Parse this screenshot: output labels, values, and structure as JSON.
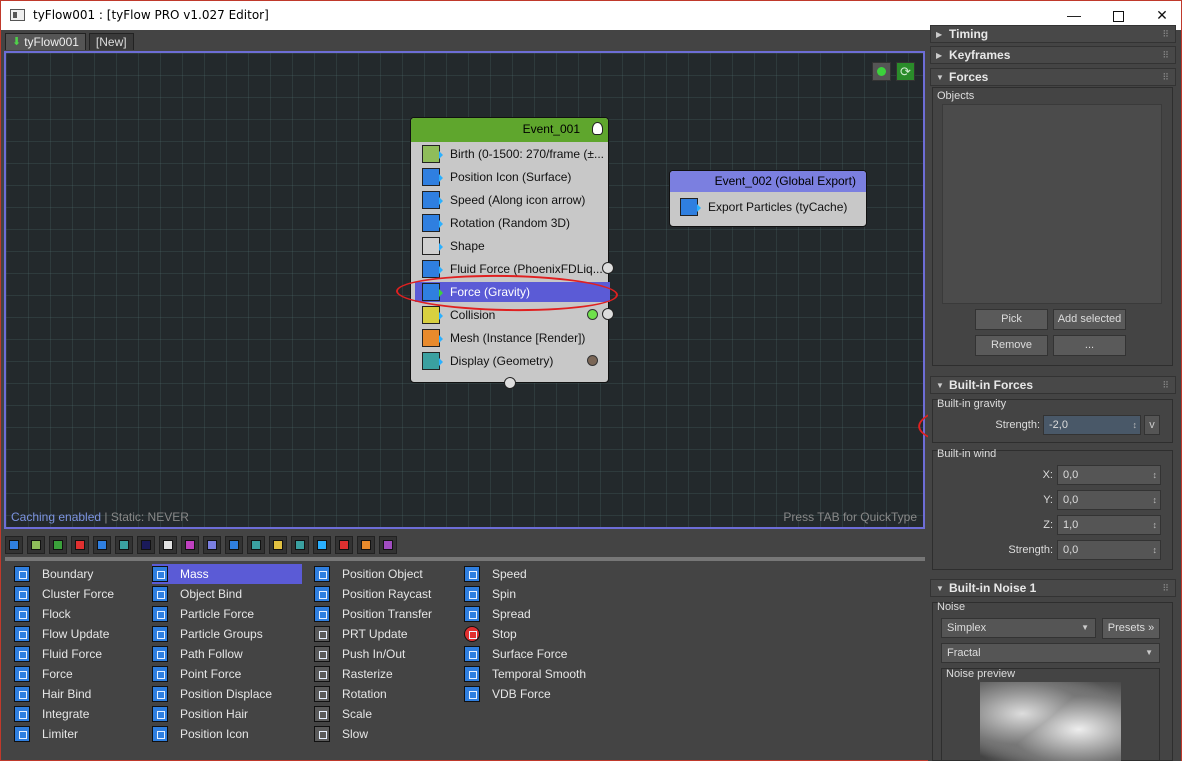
{
  "window": {
    "title": "tyFlow001 : [tyFlow PRO v1.027 Editor]",
    "min": "—",
    "max": "",
    "close": "✕"
  },
  "tabs": [
    {
      "label": "tyFlow001",
      "icon": "green-down-arrow-icon"
    },
    {
      "label": "[New]"
    }
  ],
  "canvas": {
    "status_caching": "Caching enabled",
    "status_static": " | Static: NEVER",
    "hint": "Press TAB for QuickType",
    "refresh_glyph": "⟳"
  },
  "event1": {
    "title": "Event_001",
    "operators": [
      {
        "label": "Birth (0-1500: 270/frame (±...",
        "icon": "birth"
      },
      {
        "label": "Position Icon (Surface)",
        "icon": "blue"
      },
      {
        "label": "Speed (Along icon arrow)",
        "icon": "blue"
      },
      {
        "label": "Rotation (Random 3D)",
        "icon": "blue"
      },
      {
        "label": "Shape",
        "icon": "shape"
      },
      {
        "label": "Fluid Force (PhoenixFDLiq...",
        "icon": "blue"
      },
      {
        "label": "Force (Gravity)",
        "icon": "grav",
        "selected": true
      },
      {
        "label": "Collision",
        "icon": "col"
      },
      {
        "label": "Mesh (Instance [Render])",
        "icon": "mesh"
      },
      {
        "label": "Display (Geometry)",
        "icon": "disp"
      }
    ]
  },
  "event2": {
    "title": "Event_002 (Global Export)",
    "operator": "Export Particles (tyCache)"
  },
  "palette": {
    "colors": [
      "#2f7fe0",
      "#8fbd5a",
      "#3aa03a",
      "#e03030",
      "#2f7fe0",
      "#3aa0a0",
      "#1a1a5a",
      "#e0e0e0",
      "#c040c0",
      "#7b7fe0",
      "#2f7fe0",
      "#3aa0a0",
      "#e0c040",
      "#3aa0a0",
      "#2ab0ff",
      "#e03030",
      "#e88a2c",
      "#a04cc0"
    ],
    "col1": [
      "Boundary",
      "Cluster Force",
      "Flock",
      "Flow Update",
      "Fluid Force",
      "Force",
      "Hair Bind",
      "Integrate",
      "Limiter"
    ],
    "col2": [
      "Mass",
      "Object Bind",
      "Particle Force",
      "Particle Groups",
      "Path Follow",
      "Point Force",
      "Position Displace",
      "Position Hair",
      "Position Icon"
    ],
    "col3": [
      "Position Object",
      "Position Raycast",
      "Position Transfer",
      "PRT Update",
      "Push In/Out",
      "Rasterize",
      "Rotation",
      "Scale",
      "Slow"
    ],
    "col4": [
      "Speed",
      "Spin",
      "Spread",
      "Stop",
      "Surface Force",
      "Temporal Smooth",
      "VDB Force"
    ]
  },
  "panel": {
    "timing": "Timing",
    "keyframes": "Keyframes",
    "forces": "Forces",
    "objects_label": "Objects",
    "pick": "Pick",
    "add_selected": "Add selected",
    "remove": "Remove",
    "more": "...",
    "builtin_forces": "Built-in Forces",
    "builtin_gravity": "Built-in gravity",
    "strength_label": "Strength:",
    "gravity_strength": "-2,0",
    "v": "v",
    "builtin_wind": "Built-in wind",
    "x_label": "X:",
    "x_val": "0,0",
    "y_label": "Y:",
    "y_val": "0,0",
    "z_label": "Z:",
    "z_val": "1,0",
    "wind_strength_label": "Strength:",
    "wind_strength": "0,0",
    "builtin_noise": "Built-in Noise 1",
    "noise_label": "Noise",
    "noise_type": "Simplex",
    "presets": "Presets »",
    "fractal": "Fractal",
    "noise_preview": "Noise preview"
  }
}
